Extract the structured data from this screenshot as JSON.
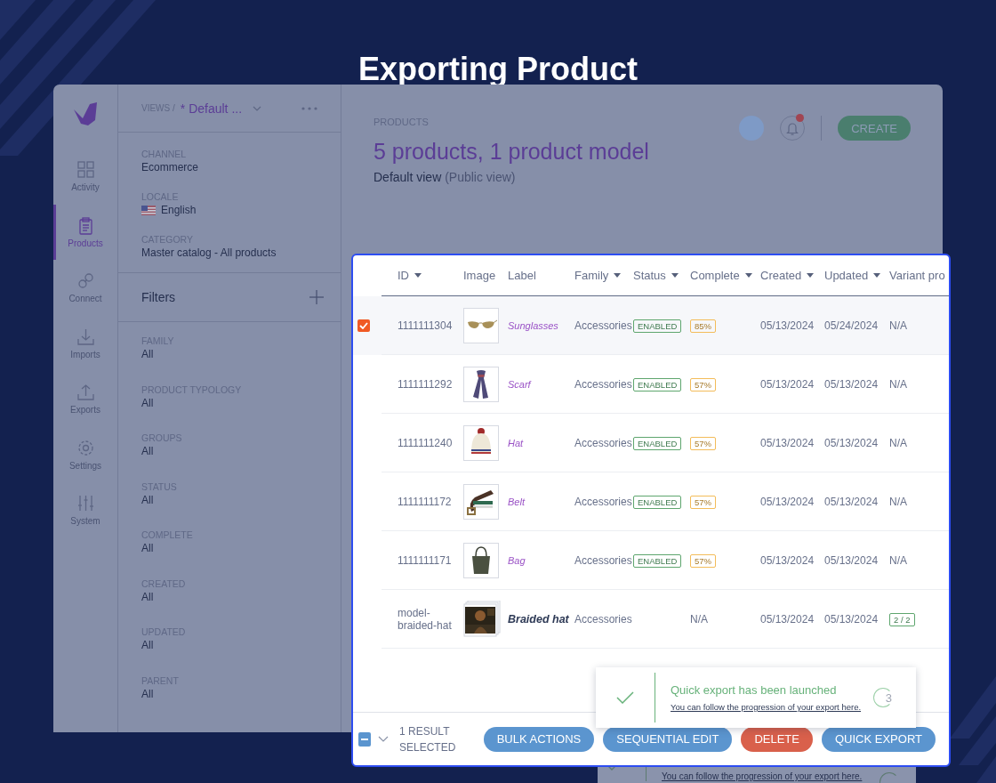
{
  "page_title": "Exporting Product",
  "nav": {
    "items": [
      {
        "label": "Activity",
        "selected": false
      },
      {
        "label": "Products",
        "selected": true
      },
      {
        "label": "Connect",
        "selected": false
      },
      {
        "label": "Imports",
        "selected": false
      },
      {
        "label": "Exports",
        "selected": false
      },
      {
        "label": "Settings",
        "selected": false
      },
      {
        "label": "System",
        "selected": false
      }
    ]
  },
  "views": {
    "prefix": "VIEWS /",
    "current": "* Default ..."
  },
  "context": [
    {
      "kind": "plain",
      "label": "CHANNEL",
      "value": "Ecommerce"
    },
    {
      "kind": "locale",
      "label": "LOCALE",
      "value": "English"
    },
    {
      "kind": "plain",
      "label": "CATEGORY",
      "value": "Master catalog - All products"
    }
  ],
  "filters": {
    "title": "Filters",
    "items": [
      {
        "label": "FAMILY",
        "value": "All"
      },
      {
        "label": "PRODUCT TYPOLOGY",
        "value": "All"
      },
      {
        "label": "GROUPS",
        "value": "All"
      },
      {
        "label": "STATUS",
        "value": "All"
      },
      {
        "label": "COMPLETE",
        "value": "All"
      },
      {
        "label": "CREATED",
        "value": "All"
      },
      {
        "label": "UPDATED",
        "value": "All"
      },
      {
        "label": "PARENT",
        "value": "All"
      }
    ]
  },
  "header": {
    "breadcrumb": "PRODUCTS",
    "title": "5 products, 1 product model",
    "view_name": "Default view",
    "view_note": "(Public view)",
    "create_button": "CREATE",
    "unread_notifications": true
  },
  "table": {
    "columns": [
      {
        "label": "ID",
        "sortable": true
      },
      {
        "label": "Image",
        "sortable": false
      },
      {
        "label": "Label",
        "sortable": false
      },
      {
        "label": "Family",
        "sortable": true
      },
      {
        "label": "Status",
        "sortable": true
      },
      {
        "label": "Complete",
        "sortable": true
      },
      {
        "label": "Created",
        "sortable": true
      },
      {
        "label": "Updated",
        "sortable": true
      },
      {
        "label": "Variant pro"
      }
    ],
    "rows": [
      {
        "kind": "product",
        "selected": true,
        "id": "1111111304",
        "label": "Sunglasses",
        "family": "Accessories",
        "status": "ENABLED",
        "complete": "85%",
        "created": "05/13/2024",
        "updated": "05/24/2024",
        "variant": "N/A"
      },
      {
        "kind": "product",
        "selected": false,
        "id": "1111111292",
        "label": "Scarf",
        "family": "Accessories",
        "status": "ENABLED",
        "complete": "57%",
        "created": "05/13/2024",
        "updated": "05/13/2024",
        "variant": "N/A"
      },
      {
        "kind": "product",
        "selected": false,
        "id": "1111111240",
        "label": "Hat",
        "family": "Accessories",
        "status": "ENABLED",
        "complete": "57%",
        "created": "05/13/2024",
        "updated": "05/13/2024",
        "variant": "N/A"
      },
      {
        "kind": "product",
        "selected": false,
        "id": "1111111172",
        "label": "Belt",
        "family": "Accessories",
        "status": "ENABLED",
        "complete": "57%",
        "created": "05/13/2024",
        "updated": "05/13/2024",
        "variant": "N/A"
      },
      {
        "kind": "product",
        "selected": false,
        "id": "1111111171",
        "label": "Bag",
        "family": "Accessories",
        "status": "ENABLED",
        "complete": "57%",
        "created": "05/13/2024",
        "updated": "05/13/2024",
        "variant": "N/A"
      },
      {
        "kind": "model",
        "selected": false,
        "id": "model-braided-hat",
        "label": "Braided hat",
        "family": "Accessories",
        "complete": "N/A",
        "created": "05/13/2024",
        "updated": "05/13/2024",
        "variant": "2 / 2"
      }
    ]
  },
  "footer": {
    "indeterminate": true,
    "selection_label": "1 RESULT SELECTED",
    "buttons": [
      {
        "label": "BULK ACTIONS",
        "kind": "primary"
      },
      {
        "label": "SEQUENTIAL EDIT",
        "kind": "primary"
      },
      {
        "label": "DELETE",
        "kind": "danger"
      },
      {
        "label": "QUICK EXPORT",
        "kind": "primary"
      }
    ]
  },
  "toast": {
    "title": "Quick export has been launched",
    "link": "You can follow the progression of your export here.",
    "countdown": "3"
  },
  "background_toast": {
    "link": "You can follow the progression of your export here."
  }
}
